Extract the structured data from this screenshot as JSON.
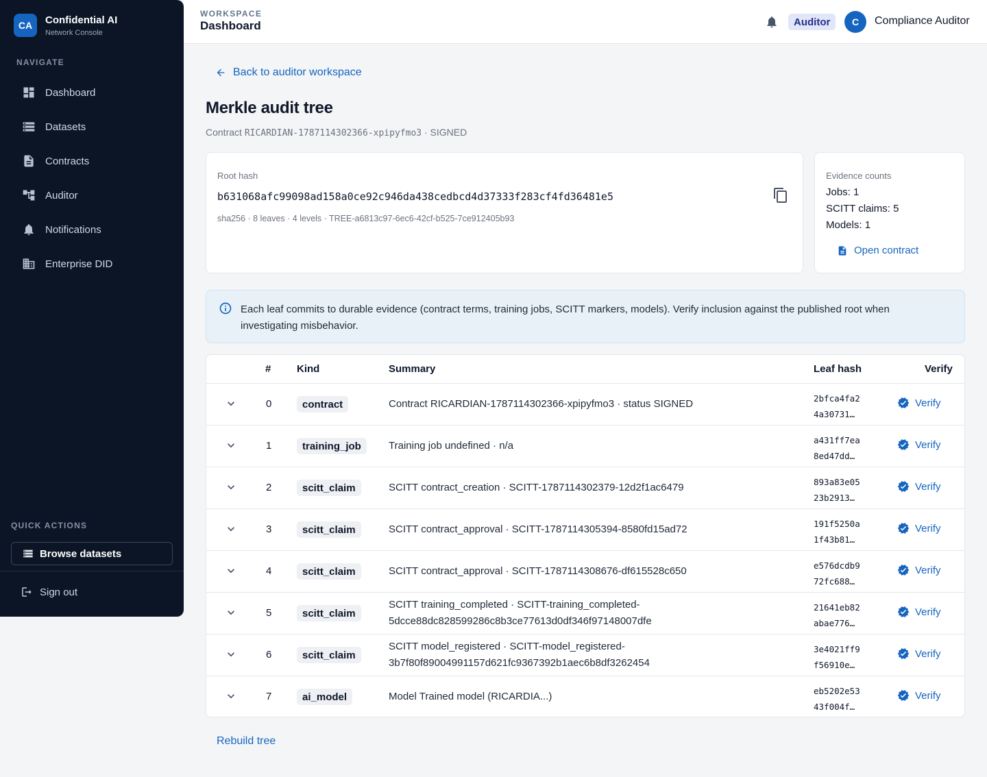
{
  "sidebar": {
    "logo": "CA",
    "title": "Confidential AI",
    "subtitle": "Network Console",
    "nav_label": "NAVIGATE",
    "items": [
      {
        "label": "Dashboard",
        "icon": "dashboard-icon"
      },
      {
        "label": "Datasets",
        "icon": "datasets-icon"
      },
      {
        "label": "Contracts",
        "icon": "document-icon"
      },
      {
        "label": "Auditor",
        "icon": "tree-icon"
      },
      {
        "label": "Notifications",
        "icon": "bell-icon"
      },
      {
        "label": "Enterprise DID",
        "icon": "building-icon"
      }
    ],
    "quick_actions_label": "QUICK ACTIONS",
    "browse_datasets": "Browse datasets",
    "sign_out": "Sign out"
  },
  "topbar": {
    "workspace_label": "WORKSPACE",
    "title": "Dashboard",
    "role": "Auditor",
    "avatar": "C",
    "user_name": "Compliance Auditor"
  },
  "page": {
    "back_link": "Back to auditor workspace",
    "title": "Merkle audit tree",
    "subtitle_prefix": "Contract",
    "contract_id": "RICARDIAN-1787114302366-xpipyfmo3",
    "subtitle_suffix": "· SIGNED"
  },
  "root": {
    "label": "Root hash",
    "hash": "b631068afc99098ad158a0ce92c946da438cedbcd4d37333f283cf4fd36481e5",
    "meta": "sha256 · 8 leaves · 4 levels · TREE-a6813c97-6ec6-42cf-b525-7ce912405b93"
  },
  "evidence": {
    "label": "Evidence counts",
    "jobs": "Jobs: 1",
    "claims": "SCITT claims: 5",
    "models": "Models: 1",
    "open_contract": "Open contract"
  },
  "info": {
    "text": "Each leaf commits to durable evidence (contract terms, training jobs, SCITT markers, models). Verify inclusion against the published root when investigating misbehavior."
  },
  "table": {
    "headers": {
      "index": "#",
      "kind": "Kind",
      "summary": "Summary",
      "leaf": "Leaf hash",
      "verify": "Verify"
    },
    "verify_label": "Verify",
    "rows": [
      {
        "index": "0",
        "kind": "contract",
        "summary": "Contract RICARDIAN-1787114302366-xpipyfmo3 · status SIGNED",
        "leaf1": "2bfca4fa2",
        "leaf2": "4a30731…"
      },
      {
        "index": "1",
        "kind": "training_job",
        "summary": "Training job undefined · n/a",
        "leaf1": "a431ff7ea",
        "leaf2": "8ed47dd…"
      },
      {
        "index": "2",
        "kind": "scitt_claim",
        "summary": "SCITT contract_creation · SCITT-1787114302379-12d2f1ac6479",
        "leaf1": "893a83e05",
        "leaf2": "23b2913…"
      },
      {
        "index": "3",
        "kind": "scitt_claim",
        "summary": "SCITT contract_approval · SCITT-1787114305394-8580fd15ad72",
        "leaf1": "191f5250a",
        "leaf2": "1f43b81…"
      },
      {
        "index": "4",
        "kind": "scitt_claim",
        "summary": "SCITT contract_approval · SCITT-1787114308676-df615528c650",
        "leaf1": "e576dcdb9",
        "leaf2": "72fc688…"
      },
      {
        "index": "5",
        "kind": "scitt_claim",
        "summary": "SCITT training_completed · SCITT-training_completed-5dcce88dc828599286c8b3ce77613d0df346f97148007dfe",
        "leaf1": "21641eb82",
        "leaf2": "abae776…"
      },
      {
        "index": "6",
        "kind": "scitt_claim",
        "summary": "SCITT model_registered · SCITT-model_registered-3b7f80f89004991157d621fc9367392b1aec6b8df3262454",
        "leaf1": "3e4021ff9",
        "leaf2": "f56910e…"
      },
      {
        "index": "7",
        "kind": "ai_model",
        "summary": "Model Trained model (RICARDIA...)",
        "leaf1": "eb5202e53",
        "leaf2": "43f004f…"
      }
    ]
  },
  "rebuild": "Rebuild tree",
  "colors": {
    "accent": "#1565c0",
    "sidebar": "#0b1526",
    "badge": "#e1e6f8"
  }
}
